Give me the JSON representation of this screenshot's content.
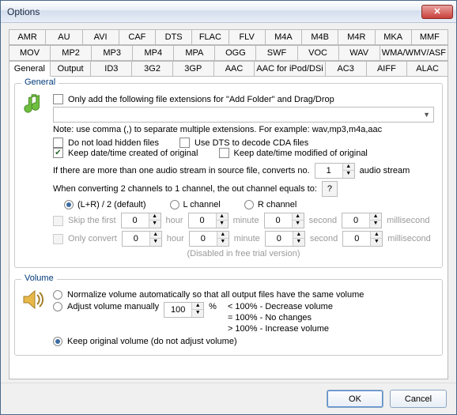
{
  "window": {
    "title": "Options",
    "ok": "OK",
    "cancel": "Cancel"
  },
  "tabs": {
    "row1": [
      "AMR",
      "AU",
      "AVI",
      "CAF",
      "DTS",
      "FLAC",
      "FLV",
      "M4A",
      "M4B",
      "M4R",
      "MKA",
      "MMF"
    ],
    "row2": [
      "MOV",
      "MP2",
      "MP3",
      "MP4",
      "MPA",
      "OGG",
      "SWF",
      "VOC",
      "WAV",
      "WMA/WMV/ASF"
    ],
    "row3": [
      "General",
      "Output",
      "ID3",
      "3G2",
      "3GP",
      "AAC",
      "AAC for iPod/DSi",
      "AC3",
      "AIFF",
      "ALAC"
    ],
    "active": "General"
  },
  "general": {
    "legend": "General",
    "only_add_ext": "Only add the following file extensions for \"Add Folder\" and Drag/Drop",
    "ext_value": "",
    "note": "Note: use comma (,) to separate multiple extensions. For example: wav,mp3,m4a,aac",
    "no_hidden": "Do not load hidden files",
    "use_dts": "Use DTS to decode CDA files",
    "keep_created": "Keep date/time created of original",
    "keep_modified": "Keep date/time modified of original",
    "stream_pre": "If there are more than one audio stream in source file, converts no.",
    "stream_val": "1",
    "stream_suf": "audio stream",
    "downmix": "When converting 2 channels to 1 channel, the out channel equals to:",
    "help": "?",
    "dm_opt1": "(L+R) / 2 (default)",
    "dm_opt2": "L channel",
    "dm_opt3": "R channel",
    "skip": "Skip the first",
    "onlyconv": "Only convert",
    "u_hour": "hour",
    "u_min": "minute",
    "u_sec": "second",
    "u_ms": "millisecond",
    "trial": "(Disabled in free trial version)",
    "t_h1": "0",
    "t_m1": "0",
    "t_s1": "0",
    "t_ms1": "0",
    "t_h2": "0",
    "t_m2": "0",
    "t_s2": "0",
    "t_ms2": "0"
  },
  "volume": {
    "legend": "Volume",
    "normalize": "Normalize volume automatically so that all output files have the same volume",
    "adjust": "Adjust volume manually",
    "adjust_val": "100",
    "adjust_unit": "%",
    "keep": "Keep original volume (do not adjust volume)",
    "hint1": "< 100% - Decrease volume",
    "hint2": "= 100% - No changes",
    "hint3": "> 100% - Increase volume"
  }
}
